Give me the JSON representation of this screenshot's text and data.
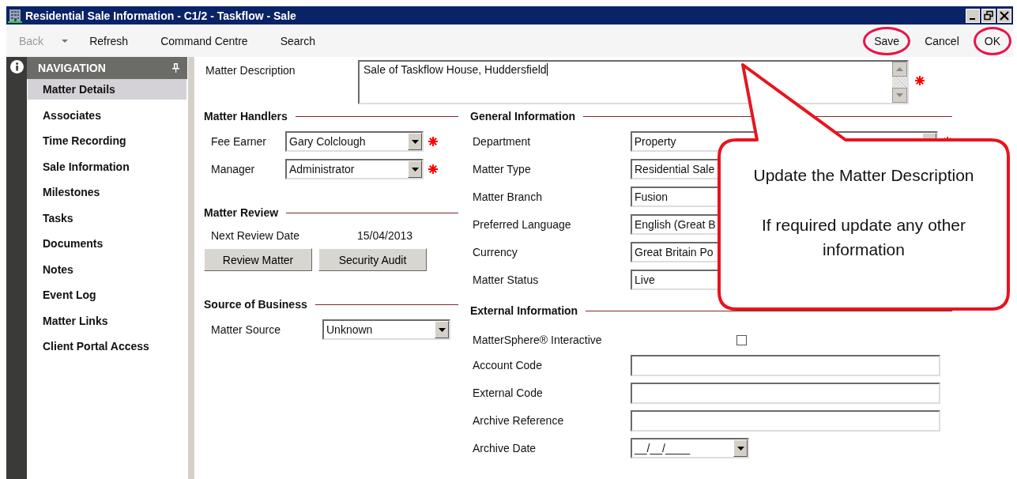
{
  "window": {
    "title": "Residential Sale Information - C1/2 - Taskflow - Sale"
  },
  "toolbar": {
    "left": [
      {
        "kind": "button",
        "label": "Back",
        "disabled": true,
        "highlighted": false
      },
      {
        "kind": "caret"
      },
      {
        "kind": "button",
        "label": "Refresh",
        "disabled": false,
        "highlighted": false
      },
      {
        "kind": "button",
        "label": "Command Centre",
        "disabled": false,
        "highlighted": false
      },
      {
        "kind": "button",
        "label": "Search",
        "disabled": false,
        "highlighted": false
      }
    ],
    "right": [
      {
        "kind": "button",
        "label": "Save",
        "disabled": false,
        "highlighted": true
      },
      {
        "kind": "button",
        "label": "Cancel",
        "disabled": false,
        "highlighted": false
      },
      {
        "kind": "button",
        "label": "OK",
        "disabled": false,
        "highlighted": true
      }
    ]
  },
  "navigation": {
    "title": "NAVIGATION",
    "items": [
      {
        "label": "Matter Details",
        "selected": true
      },
      {
        "label": "Associates",
        "selected": false
      },
      {
        "label": "Time Recording",
        "selected": false
      },
      {
        "label": "Sale Information",
        "selected": false
      },
      {
        "label": "Milestones",
        "selected": false
      },
      {
        "label": "Tasks",
        "selected": false
      },
      {
        "label": "Documents",
        "selected": false
      },
      {
        "label": "Notes",
        "selected": false
      },
      {
        "label": "Event Log",
        "selected": false
      },
      {
        "label": "Matter Links",
        "selected": false
      },
      {
        "label": "Client Portal Access",
        "selected": false
      }
    ]
  },
  "matter_description": {
    "label": "Matter Description",
    "value": "Sale of Taskflow House, Huddersfield",
    "required": true
  },
  "left_column": [
    {
      "title": "Matter Handlers",
      "fields": [
        {
          "kind": "dropdown",
          "label": "Fee Earner",
          "value": "Gary Colclough",
          "required": true
        },
        {
          "kind": "dropdown",
          "label": "Manager",
          "value": "Administrator",
          "required": true
        }
      ]
    },
    {
      "title": "Matter Review",
      "fields": [
        {
          "kind": "text",
          "label": "Next Review Date",
          "value": "15/04/2013"
        },
        {
          "kind": "buttons",
          "buttons": [
            "Review Matter",
            "Security Audit"
          ]
        }
      ]
    },
    {
      "title": "Source of Business",
      "fields": [
        {
          "kind": "dropdown",
          "label": "Matter Source",
          "value": "Unknown"
        }
      ]
    }
  ],
  "right_column": [
    {
      "title": "General Information",
      "fields": [
        {
          "kind": "dropdown",
          "label": "Department",
          "value": "Property",
          "required": true
        },
        {
          "kind": "dropdown",
          "label": "Matter Type",
          "value": "Residential Sale"
        },
        {
          "kind": "dropdown",
          "label": "Matter Branch",
          "value": "Fusion"
        },
        {
          "kind": "dropdown",
          "label": "Preferred Language",
          "value": "English (Great B"
        },
        {
          "kind": "dropdown",
          "label": "Currency",
          "value": "Great Britain Po"
        },
        {
          "kind": "dropdown",
          "label": "Matter Status",
          "value": "Live"
        }
      ]
    },
    {
      "title": "External Information",
      "fields": [
        {
          "kind": "checkbox",
          "label": "MatterSphere® Interactive",
          "checked": false
        },
        {
          "kind": "input",
          "label": "Account Code"
        },
        {
          "kind": "input",
          "label": "External Code"
        },
        {
          "kind": "input",
          "label": "Archive Reference"
        },
        {
          "kind": "date",
          "label": "Archive Date",
          "value": "__/__/____"
        }
      ]
    }
  ],
  "callout": {
    "paragraphs": [
      "Update the Matter Description",
      "If required update any other information"
    ]
  }
}
